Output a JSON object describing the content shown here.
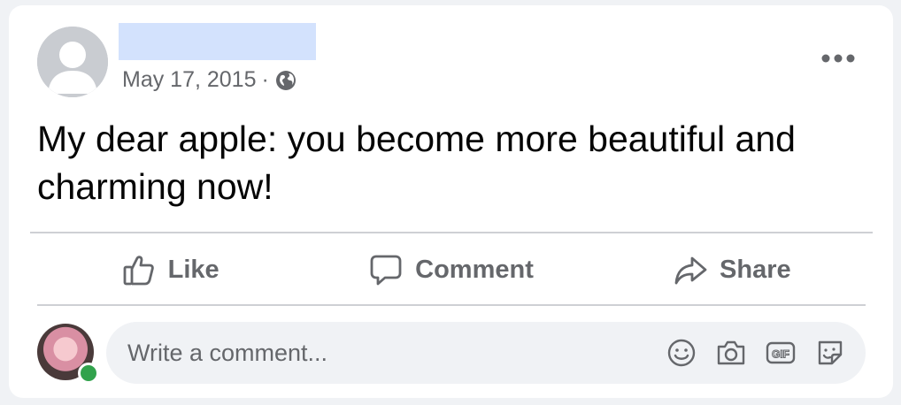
{
  "post": {
    "date": "May 17, 2015",
    "separator": "·",
    "privacy_icon": "globe-icon",
    "text": "My dear apple: you become more beautiful and charming now!"
  },
  "actions": {
    "like_label": "Like",
    "comment_label": "Comment",
    "share_label": "Share"
  },
  "comment_box": {
    "placeholder": "Write a comment...",
    "tools": [
      "emoji-icon",
      "camera-icon",
      "gif-icon",
      "sticker-icon"
    ]
  },
  "colors": {
    "secondary_text": "#65676b",
    "online": "#31a24c",
    "name_placeholder": "#d3e2fd"
  }
}
